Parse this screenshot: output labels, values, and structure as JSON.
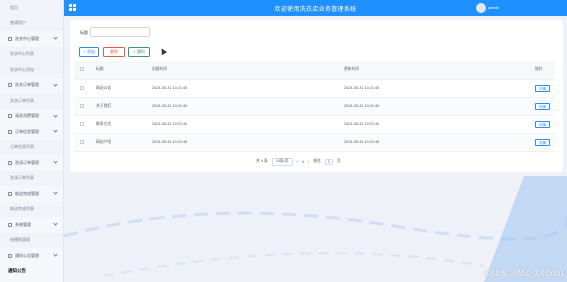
{
  "header": {
    "title": "欢迎使用洗衣店业务管理系统",
    "username": "admin"
  },
  "sidebar": {
    "items": [
      {
        "label": "首页",
        "type": "sub"
      },
      {
        "label": "普通用户",
        "type": "sub"
      },
      {
        "label": "洗衣中心管理",
        "type": "group"
      },
      {
        "label": "洗衣中心列表",
        "type": "sub"
      },
      {
        "label": "洗衣中心添加",
        "type": "sub"
      },
      {
        "label": "洗衣订单管理",
        "type": "group"
      },
      {
        "label": "洗衣订单列表",
        "type": "sub"
      },
      {
        "label": "清洗消费管理",
        "type": "group"
      },
      {
        "label": "订单信息管理",
        "type": "group"
      },
      {
        "label": "订单信息列表",
        "type": "sub"
      },
      {
        "label": "洗涤订单管理",
        "type": "group"
      },
      {
        "label": "洗涤订单列表",
        "type": "sub"
      },
      {
        "label": "取送完成管理",
        "type": "group"
      },
      {
        "label": "取送完成列表",
        "type": "sub"
      },
      {
        "label": "系统管理",
        "type": "group"
      },
      {
        "label": "轮播图管理",
        "type": "sub"
      },
      {
        "label": "通知公告管理",
        "type": "group"
      },
      {
        "label": "通知公告",
        "type": "active"
      }
    ]
  },
  "search": {
    "label": "标题",
    "value": ""
  },
  "toolbar": {
    "add_label": "+ 添加",
    "delete_label": "删除",
    "post_label": "+ 通知"
  },
  "table": {
    "columns": [
      "标题",
      "创建时间",
      "更新时间",
      "操作"
    ],
    "rows": [
      {
        "title": "网站公告",
        "created": "2024-05-31 10:21:49",
        "updated": "2024-05-31 10:21:49",
        "action": "详情"
      },
      {
        "title": "关于我们",
        "created": "2024-05-31 10:21:49",
        "updated": "2024-05-31 10:21:49",
        "action": "详情"
      },
      {
        "title": "联系方式",
        "created": "2024-05-31 10:21:49",
        "updated": "2024-05-31 10:21:49",
        "action": "详情"
      },
      {
        "title": "网站介绍",
        "created": "2024-05-31 10:21:49",
        "updated": "2024-05-31 10:21:49",
        "action": "详情"
      }
    ]
  },
  "pagination": {
    "total_text": "共 4 条",
    "page_size": "10条/页",
    "prev": "‹",
    "current_page": "1",
    "next": "›",
    "goto_label": "前往",
    "goto_value": "1",
    "goto_suffix": "页"
  },
  "watermark": "CSDN @MZ_ZXD001",
  "colors": {
    "header": "#1e90ff",
    "primary": "#2d8cf0",
    "danger": "#e45b4d",
    "success": "#3a9b6c"
  }
}
